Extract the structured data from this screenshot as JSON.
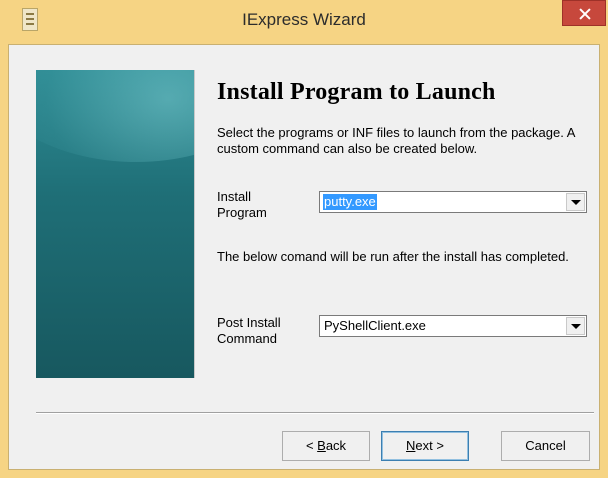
{
  "window": {
    "title": "IExpress Wizard",
    "titlebar_color": "#f6d484",
    "close_button_color": "#c7483c"
  },
  "page": {
    "heading": "Install Program to Launch",
    "description": "Select the programs or INF files to launch from the package.  A custom command can also be created below.",
    "install_program_label_line1": "Install",
    "install_program_label_line2": "Program",
    "install_program_value": "putty.exe",
    "post_info": "The below comand will be run after the install has completed.",
    "post_install_label_line1": "Post Install",
    "post_install_label_line2": "Command",
    "post_install_value": "PyShellClient.exe"
  },
  "buttons": {
    "back_prefix": "< ",
    "back_accel": "B",
    "back_rest": "ack",
    "next_accel": "N",
    "next_rest": "ext >",
    "cancel": "Cancel"
  },
  "icons": {
    "app": "installer-app-icon",
    "close": "close-icon",
    "dropdown": "chevron-down-icon"
  }
}
